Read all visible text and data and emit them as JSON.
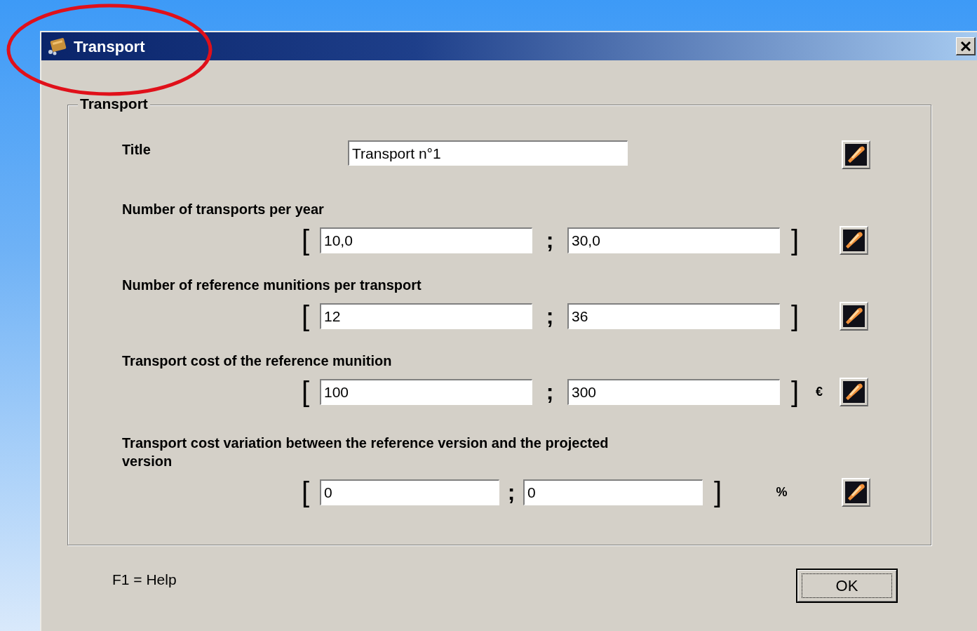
{
  "window": {
    "title": "Transport"
  },
  "group": {
    "title": "Transport"
  },
  "title_field": {
    "label": "Title",
    "value": "Transport n°1"
  },
  "ranges": [
    {
      "kind": "wide",
      "label": "Number of transports per year",
      "open": "[",
      "min": "10,0",
      "separator": ";",
      "max": "30,0",
      "close": "]"
    },
    {
      "kind": "wide",
      "label": "Number of reference munitions per transport",
      "open": "[",
      "min": "12",
      "separator": ";",
      "max": "36",
      "close": "]"
    },
    {
      "kind": "wide",
      "label": "Transport cost of the reference munition",
      "open": "[",
      "min": "100",
      "separator": ";",
      "max": "300",
      "close": "]",
      "unit": "€"
    },
    {
      "kind": "narrow",
      "label": "Transport cost variation between the reference version and the projected version",
      "open": "[",
      "min": "0",
      "separator": ";",
      "max": "0",
      "close": "]",
      "unit": "%"
    }
  ],
  "footer": {
    "help": "F1 = Help",
    "ok": "OK"
  }
}
